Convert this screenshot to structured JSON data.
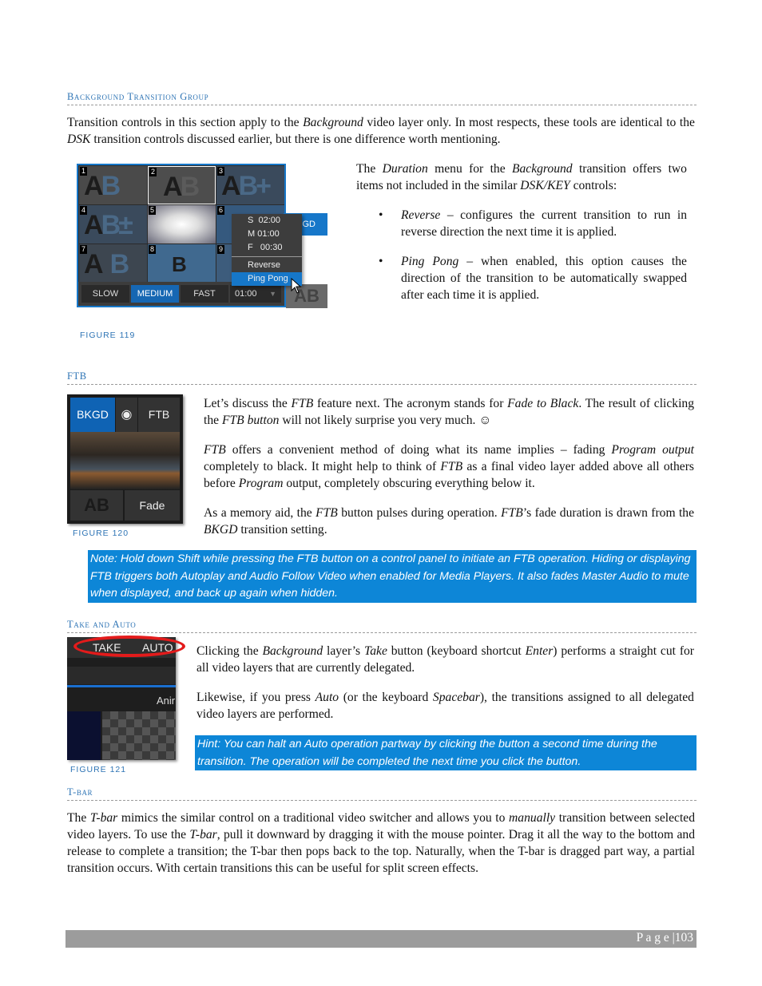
{
  "sections": {
    "background_transition_group": {
      "heading": "Background Transition Group",
      "intro": {
        "t1": "Transition controls in this section apply to the ",
        "i1": "Background",
        "t2": " video layer only. In most respects, these tools are identical to the ",
        "i2": "DSK",
        "t3": " transition controls discussed earlier, but there is one difference worth mentioning."
      },
      "side_text": {
        "t1": "The ",
        "i1": "Duration",
        "t2": " menu for the ",
        "i2": "Background",
        "t3": " transition offers two items not included in the similar ",
        "i3": "DSK/KEY",
        "t4": " controls:"
      },
      "bullets": [
        {
          "term": "Reverse",
          "text": " – configures the current transition to run in reverse direction the next time it is applied."
        },
        {
          "term": "Ping Pong",
          "text": " – when enabled, this option causes the direction of the transition to be automatically swapped after each time it is applied."
        }
      ],
      "figure": {
        "caption": "FIGURE 119",
        "tiles": [
          "1",
          "2",
          "3",
          "4",
          "5",
          "6",
          "7",
          "8",
          "9"
        ],
        "speed_buttons": [
          "SLOW",
          "MEDIUM",
          "FAST"
        ],
        "active_speed": "MEDIUM",
        "duration_value": "01:00",
        "duration_menu": {
          "presets": [
            {
              "key": "S",
              "value": "02:00"
            },
            {
              "key": "M",
              "value": "01:00"
            },
            {
              "key": "F",
              "value": "00:30"
            }
          ],
          "options": [
            "Reverse",
            "Ping Pong"
          ],
          "highlighted": "Ping Pong"
        },
        "bkgd_button_partial": "GD",
        "ab_label": "AB"
      }
    },
    "ftb": {
      "heading": "FTB",
      "p1": {
        "t1": "Let’s discuss the ",
        "i1": "FTB",
        "t2": " feature next. The acronym stands for ",
        "i2": "Fade to Black",
        "t3": ".  The result of clicking the ",
        "i3": "FTB button",
        "t4": " will not likely surprise you very much. ☺"
      },
      "p2": {
        "i1": "FTB",
        "t1": " offers a convenient method of doing what its name implies – fading ",
        "i2": "Program output",
        "t2": " completely to black.  It might help to think of ",
        "i3": "FTB",
        "t3": " as a final video layer added above all others before ",
        "i4": "Program",
        "t4": " output, completely obscuring everything below it."
      },
      "p3": {
        "t1": "As a memory aid, the ",
        "i1": "FTB",
        "t2": " button pulses during operation.  ",
        "i2": "FTB",
        "t3": "’s fade duration is drawn from the ",
        "i3": "BKGD",
        "t4": " transition setting."
      },
      "note": "Note: Hold down Shift while pressing the FTB button on a control panel to initiate an FTB operation.  Hiding or displaying FTB triggers both Autoplay and Audio Follow Video when enabled for Media Players.  It also fades Master Audio to mute when displayed, and back up again when hidden.",
      "figure": {
        "caption": "FIGURE 120",
        "bkgd_label": "BKGD",
        "ftb_label": "FTB",
        "fade_label": "Fade",
        "ab_label": "AB"
      }
    },
    "take_and_auto": {
      "heading": "Take and Auto",
      "p1": {
        "t1": "Clicking the ",
        "i1": "Background",
        "t2": " layer’s ",
        "i2": "Take",
        "t3": " button (keyboard shortcut ",
        "i3": "Enter",
        "t4": ") performs a straight cut for all video layers that are currently delegated."
      },
      "p2": {
        "t1": "Likewise, if you press ",
        "i1": "Auto",
        "t2": " (or the keyboard ",
        "i2": "Spacebar",
        "t3": "), the transitions assigned to all delegated video layers are performed."
      },
      "hint": "Hint: You can halt an Auto operation partway by clicking the button a second time during the transition. The operation will be completed the next time you click the button.",
      "figure": {
        "caption": "FIGURE 121",
        "take_label": "TAKE",
        "auto_label": "AUTO",
        "anim_partial": "Anir"
      }
    },
    "tbar": {
      "heading": "T-bar",
      "p1": {
        "t1": "The ",
        "i1": "T-bar",
        "t2": " mimics the similar control on a traditional video switcher and allows you to ",
        "i2": "manually",
        "t3": " transition between selected video layers. To use the ",
        "i3": "T-bar",
        "t4": ", pull it downward by dragging it with the mouse pointer. Drag it all the way to the bottom and release to complete a transition; the T-bar then pops back to the top. Naturally, when the T-bar is dragged part way, a partial transition occurs.  With certain transitions this can be useful for split screen effects."
      }
    }
  },
  "footer": {
    "page_label": "P a g e",
    "separator": "|",
    "page_number": "103"
  },
  "colors": {
    "heading": "#2e74b5",
    "callout_bg": "#0d86d7",
    "footer_bg": "#9c9c9c",
    "ui_blue": "#1677c9"
  }
}
